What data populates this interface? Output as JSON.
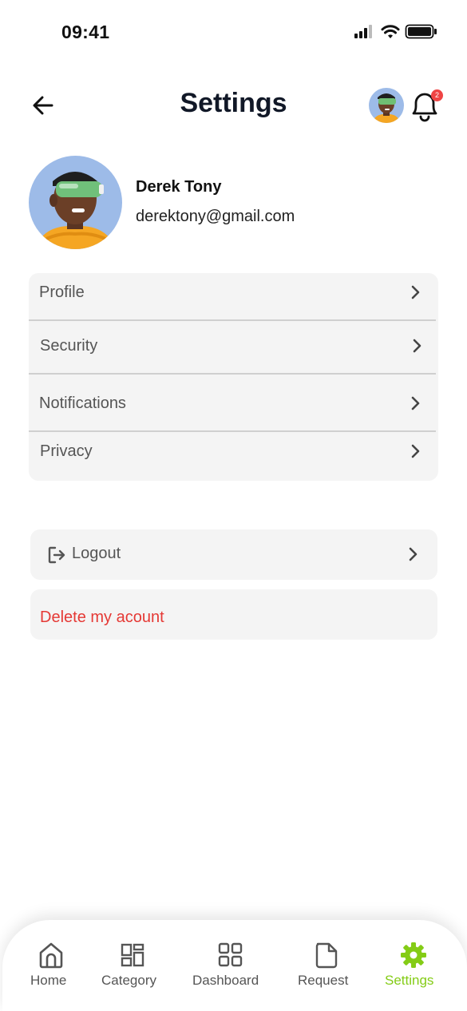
{
  "status_bar": {
    "time": "09:41"
  },
  "header": {
    "title": "Settings",
    "notification_count": "2"
  },
  "profile": {
    "name": "Derek Tony",
    "email": "derektony@gmail.com"
  },
  "settings_items": [
    {
      "label": "Profile"
    },
    {
      "label": "Security"
    },
    {
      "label": "Notifications"
    },
    {
      "label": "Privacy"
    }
  ],
  "logout": {
    "label": "Logout"
  },
  "delete_account": {
    "label": "Delete my acount"
  },
  "bottom_nav": [
    {
      "label": "Home",
      "icon": "home-icon"
    },
    {
      "label": "Category",
      "icon": "category-icon"
    },
    {
      "label": "Dashboard",
      "icon": "dashboard-icon"
    },
    {
      "label": "Request",
      "icon": "file-icon"
    },
    {
      "label": "Settings",
      "icon": "gear-icon",
      "active": true
    }
  ],
  "colors": {
    "accent": "#84cc16",
    "danger": "#e53935",
    "card_bg": "#f4f4f4",
    "badge": "#ef4444"
  }
}
